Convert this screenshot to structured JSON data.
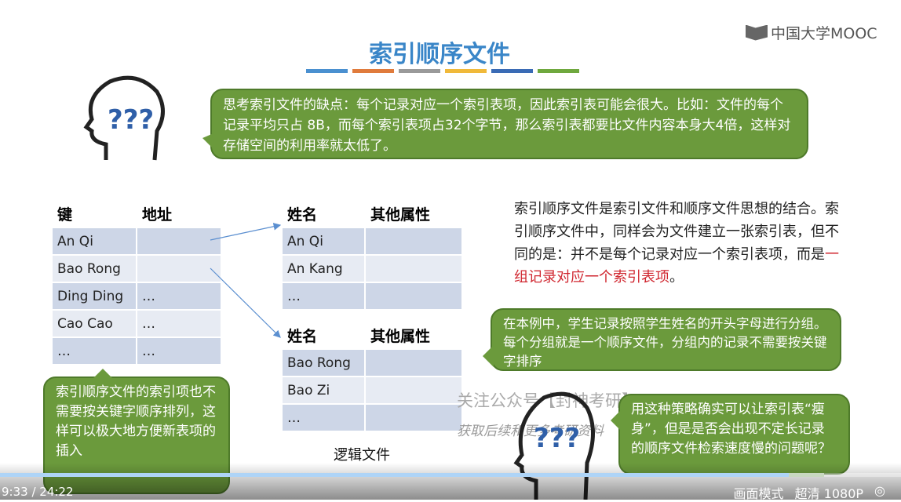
{
  "slide": {
    "title": "索引顺序文件",
    "logo": "中国大学MOOC",
    "bar_colors": [
      "#4a90d0",
      "#e07b3c",
      "#9a9a9a",
      "#f0b93a",
      "#3a6bb5",
      "#6fa83e"
    ],
    "bubble1": "思考索引文件的缺点：每个记录对应一个索引表项，因此索引表可能会很大。比如：文件的每个记录平均只占 8B，而每个索引表项占32个字节，那么索引表都要比文件内容本身大4倍，这样对存储空间的利用率就太低了。",
    "index_table": {
      "headers": [
        "键",
        "地址"
      ],
      "rows": [
        [
          "An Qi",
          ""
        ],
        [
          "Bao Rong",
          ""
        ],
        [
          "Ding Ding",
          "…"
        ],
        [
          "Cao Cao",
          "…"
        ],
        [
          "…",
          "…"
        ]
      ]
    },
    "group1": {
      "headers": [
        "姓名",
        "其他属性"
      ],
      "rows": [
        [
          "An Qi",
          ""
        ],
        [
          "An Kang",
          ""
        ],
        [
          "…",
          ""
        ]
      ]
    },
    "group2": {
      "headers": [
        "姓名",
        "其他属性"
      ],
      "rows": [
        [
          "Bao Rong",
          ""
        ],
        [
          "Bao Zi",
          ""
        ],
        [
          "…",
          ""
        ]
      ]
    },
    "caption": "逻辑文件",
    "note_part1": "索引顺序文件是索引文件和顺序文件思想的结合。索引顺序文件中，同样会为文件建立一张索引表，但不同的是：并不是每个记录对应一个索引表项，而是",
    "note_red": "一组记录对应一个索引表项",
    "note_end": "。",
    "bubble2": "在本例中，学生记录按照学生姓名的开头字母进行分组。每个分组就是一个顺序文件，分组内的记录不需要按关键字排序",
    "bubble3": "索引顺序文件的索引项也不需要按关键字顺序排列，这样可以极大地方便新表项的插入",
    "bubble4": "用这种策略确实可以让索引表“瘦身”，但是是否会出现不定长记录的顺序文件检索速度慢的问题呢？",
    "watermark1": "关注公众号【封神考研】",
    "watermark2": "获取后续和更多考研资料"
  },
  "player": {
    "time": "9:33 / 24:22",
    "progress_percent": 87.5,
    "buffered_percent": 91.5,
    "mode": "画面模式",
    "quality": "超清 1080P"
  }
}
